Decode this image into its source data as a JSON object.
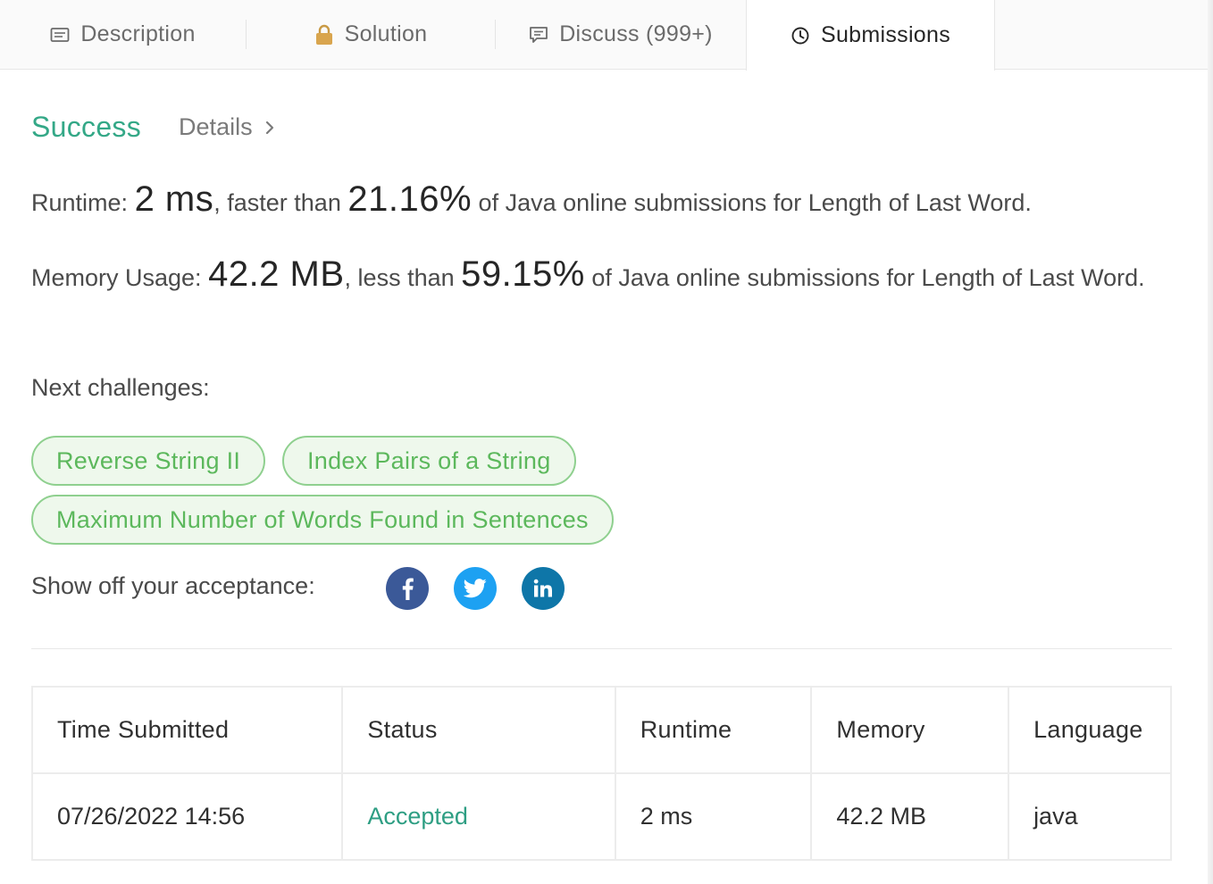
{
  "tabs": [
    {
      "label": "Description",
      "icon": "description-icon"
    },
    {
      "label": "Solution",
      "icon": "lock-icon"
    },
    {
      "label": "Discuss (999+)",
      "icon": "discuss-icon"
    },
    {
      "label": "Submissions",
      "icon": "clock-icon",
      "active": true
    }
  ],
  "result": {
    "status": "Success",
    "details_label": "Details"
  },
  "runtime": {
    "label": "Runtime:",
    "value": "2 ms",
    "comparison": ", faster than",
    "percent": "21.16%",
    "suffix": "of Java online submissions for Length of Last Word."
  },
  "memory": {
    "label": "Memory Usage:",
    "value": "42.2 MB",
    "comparison": ", less than",
    "percent": "59.15%",
    "suffix": "of Java online submissions for Length of Last Word."
  },
  "next_challenges": {
    "label": "Next challenges:",
    "items": [
      "Reverse String II",
      "Index Pairs of a String",
      "Maximum Number of Words Found in Sentences"
    ]
  },
  "share": {
    "label": "Show off your acceptance:",
    "networks": [
      "facebook-icon",
      "twitter-icon",
      "linkedin-icon"
    ]
  },
  "table": {
    "headers": [
      "Time Submitted",
      "Status",
      "Runtime",
      "Memory",
      "Language"
    ],
    "rows": [
      [
        "07/26/2022 14:56",
        "Accepted",
        "2 ms",
        "42.2 MB",
        "java"
      ]
    ]
  },
  "colors": {
    "success": "#34a887",
    "chip_border": "#8fd08f",
    "chip_text": "#5cb85c",
    "facebook": "#3b5998",
    "twitter": "#1da1f2",
    "linkedin": "#0e76a8"
  }
}
